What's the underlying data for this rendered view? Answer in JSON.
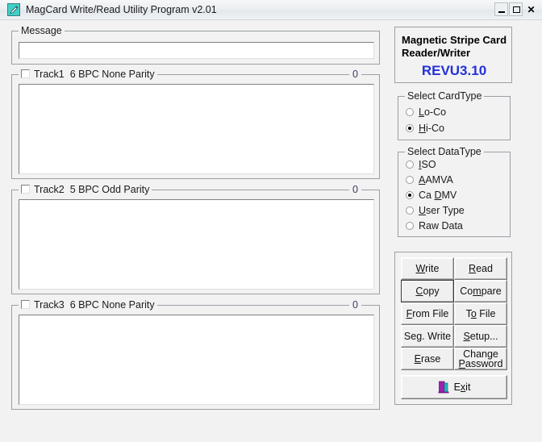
{
  "window": {
    "title": "MagCard Write/Read Utility Program v2.01",
    "icon": "pencil-card-icon",
    "controls": {
      "minimize": "minimize-icon",
      "maximize": "maximize-icon",
      "close": "close-icon"
    }
  },
  "message": {
    "legend": "Message",
    "value": "",
    "placeholder": ""
  },
  "tracks": [
    {
      "legend_checkbox_label": "Track1",
      "legend_mnemonic": "1",
      "legend_info": "6 BPC  None Parity",
      "checked": false,
      "count": "0",
      "value": ""
    },
    {
      "legend_checkbox_label": "Track2",
      "legend_mnemonic": "2",
      "legend_info": "5 BPC  Odd Parity",
      "checked": false,
      "count": "0",
      "value": ""
    },
    {
      "legend_checkbox_label": "Track3",
      "legend_mnemonic": "3",
      "legend_info": "6 BPC  None Parity",
      "checked": false,
      "count": "0",
      "value": ""
    }
  ],
  "brand": {
    "line1": "Magnetic Stripe Card",
    "line2": "Reader/Writer",
    "revision": "REVU3.10",
    "revision_color": "#2431d6"
  },
  "card_type": {
    "legend": "Select CardType",
    "options": [
      {
        "label": "Lo-Co",
        "mnemonic": "L",
        "selected": false
      },
      {
        "label": "Hi-Co",
        "mnemonic": "H",
        "selected": true
      }
    ]
  },
  "data_type": {
    "legend": "Select DataType",
    "options": [
      {
        "label": "ISO",
        "mnemonic": "I",
        "selected": false
      },
      {
        "label": "AAMVA",
        "mnemonic": "A",
        "selected": false
      },
      {
        "label": "Ca DMV",
        "mnemonic": "D",
        "selected": true
      },
      {
        "label": "User Type",
        "mnemonic": "U",
        "selected": false
      },
      {
        "label": "Raw Data",
        "mnemonic": "R",
        "selected": false
      }
    ]
  },
  "buttons": {
    "write": "Write",
    "read": "Read",
    "copy": "Copy",
    "compare": "Compare",
    "from_file": "From File",
    "to_file": "To File",
    "seg_write": "Seg. Write",
    "setup": "Setup...",
    "erase": "Erase",
    "change_password_line1": "Change",
    "change_password_line2": "Password",
    "exit": "Exit"
  }
}
